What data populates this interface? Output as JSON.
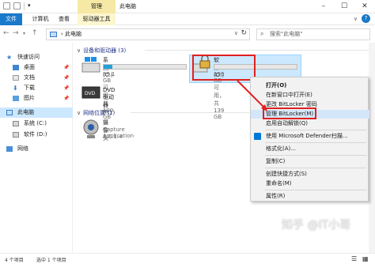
{
  "window": {
    "title": "此电脑",
    "manage_label": "管理"
  },
  "ribbon": {
    "tabs": [
      "文件",
      "计算机",
      "查看",
      "驱动器工具"
    ]
  },
  "address": {
    "crumb": "此电脑",
    "search_placeholder": "搜索\"此电脑\""
  },
  "sidebar": {
    "items": [
      {
        "label": "快速访问",
        "icon": "star-icon"
      },
      {
        "label": "桌面",
        "icon": "desktop-folder-icon"
      },
      {
        "label": "文档",
        "icon": "documents-folder-icon"
      },
      {
        "label": "下载",
        "icon": "downloads-folder-icon"
      },
      {
        "label": "图片",
        "icon": "pictures-folder-icon"
      },
      {
        "label": "此电脑",
        "icon": "computer-icon"
      },
      {
        "label": "系统 (C:)",
        "icon": "drive-icon"
      },
      {
        "label": "软件 (D:)",
        "icon": "drive-icon"
      },
      {
        "label": "网络",
        "icon": "network-icon"
      }
    ]
  },
  "main": {
    "group_devices": "设备和驱动器 (3)",
    "group_network": "网络位置 (1)",
    "drives": [
      {
        "name": "系统 (C:)",
        "free_text": "89.1 GB 可用，共 100 GB",
        "used_fraction": 0.11
      },
      {
        "name": "软件 (D:)",
        "free_text": "139 GB 可用，共 139 GB",
        "used_fraction": 0.0
      },
      {
        "name": "DVD 驱动器 (F:)",
        "free_text": "",
        "used_fraction": 0
      }
    ],
    "network_item": {
      "name": "摄像头",
      "subtitle": "Capture Application",
      "version": "1.0.1.4"
    }
  },
  "context_menu": {
    "items": [
      {
        "label": "打开(O)",
        "bold": true
      },
      {
        "label": "在新窗口中打开(E)"
      },
      {
        "label": "更改 BitLocker 密码"
      },
      {
        "label": "管理 BitLocker(M)",
        "highlight": true
      },
      {
        "label": "启用自动解锁(Q)"
      },
      {
        "label": "使用 Microsoft Defender扫描..."
      },
      {
        "label": "格式化(A)..."
      },
      {
        "label": "复制(C)"
      },
      {
        "label": "创建快捷方式(S)"
      },
      {
        "label": "重命名(M)"
      },
      {
        "label": "属性(R)"
      }
    ]
  },
  "status": {
    "count": "4 个项目",
    "selected": "选中 1 个项目"
  },
  "watermark": "知乎 @IT小哥"
}
